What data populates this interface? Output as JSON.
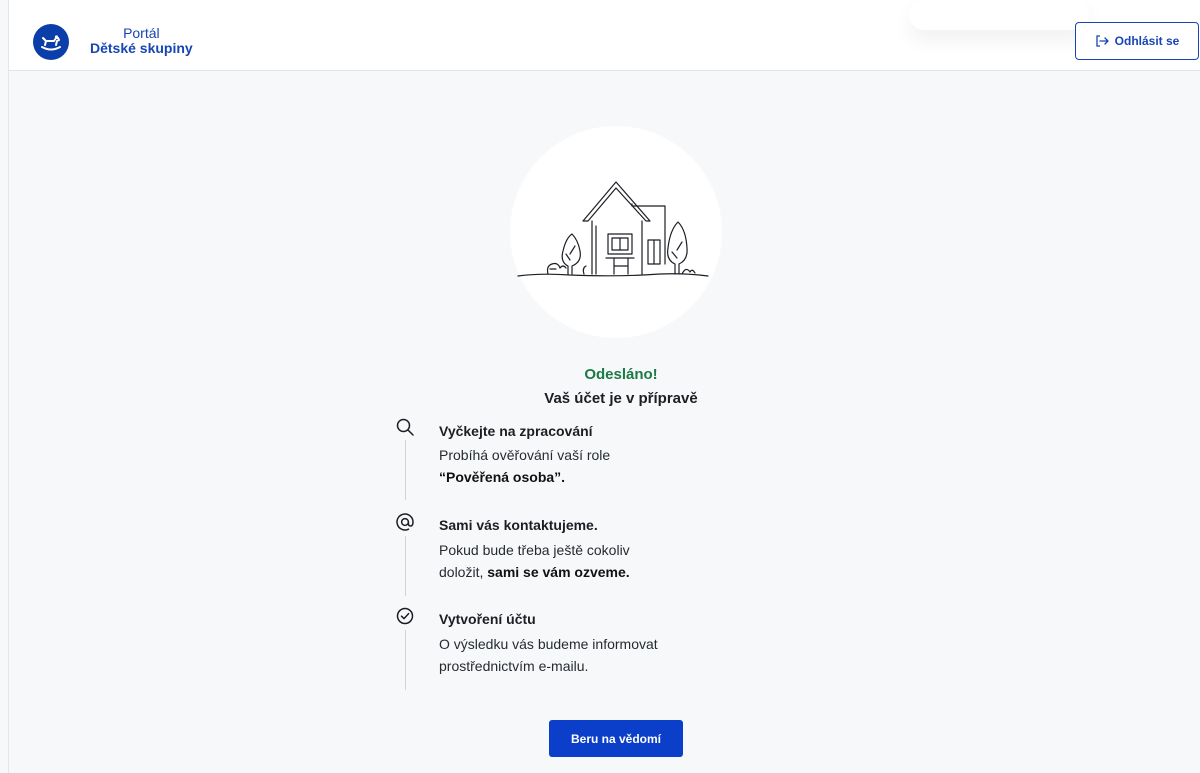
{
  "header": {
    "brand_top": "Portál",
    "brand_bottom": "Dětské skupiny",
    "logout_label": "Odhlásit se",
    "logo_icon": "rocking-horse-icon",
    "accent_color": "#1746b4"
  },
  "main": {
    "status_title": "Odesláno!",
    "subtitle": "Vaš účet je v přípravě",
    "illustration": "house-line-drawing",
    "steps": [
      {
        "icon": "search-icon",
        "title": "Vyčkejte na zpracování",
        "text_1": "Probíhá ověřování vaší role",
        "text_2_bold": "“Pověřená osoba”."
      },
      {
        "icon": "at-sign-icon",
        "title": "Sami vás kontaktujeme.",
        "text_1": "Pokud bude třeba ještě cokoliv",
        "text_2_pre": "doložit, ",
        "text_2_bold": "sami se vám ozveme."
      },
      {
        "icon": "check-circle-icon",
        "title": "Vytvoření účtu",
        "text_1": "O výsledku vás budeme informovat",
        "text_2": "prostřednictvím e-mailu."
      }
    ],
    "confirm_label": "Beru na vědomí",
    "status_color": "#1c7a45",
    "button_color": "#0b3ec9"
  }
}
